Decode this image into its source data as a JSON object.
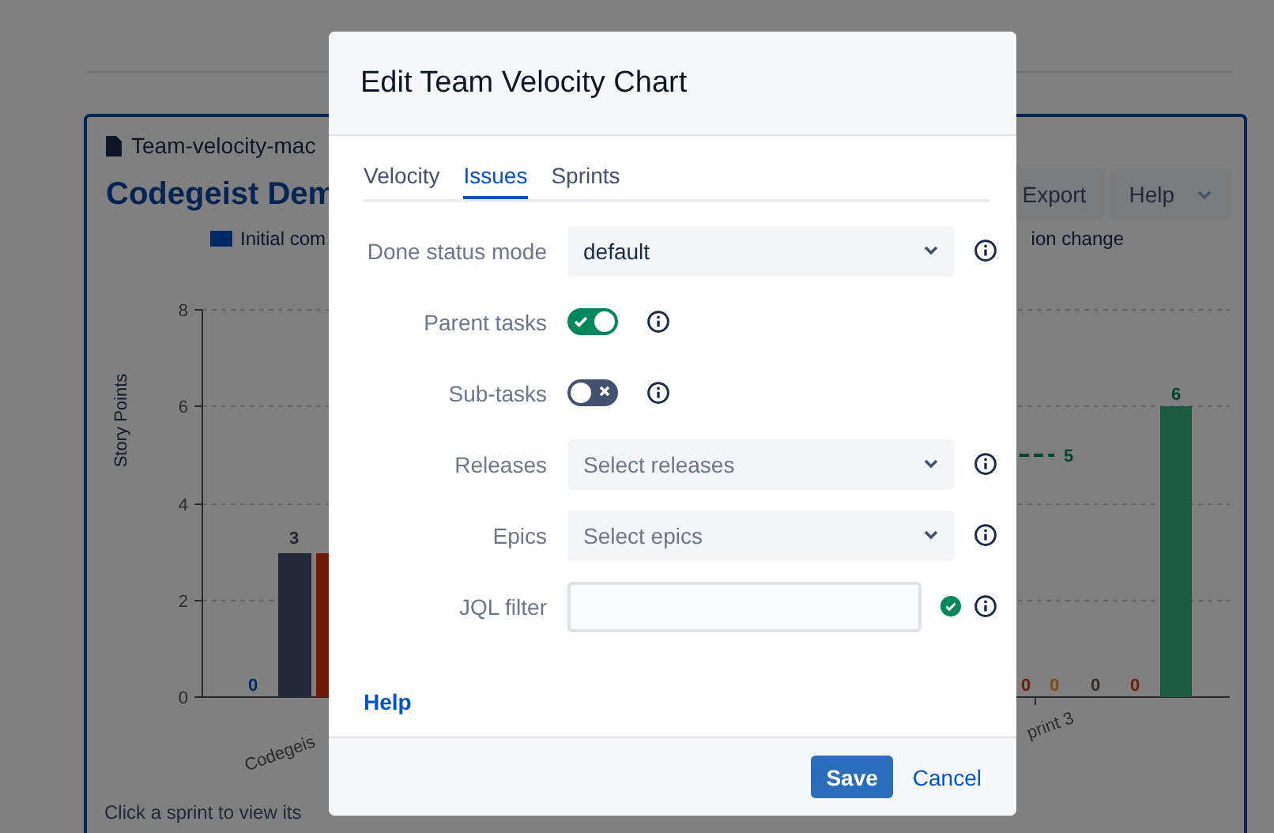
{
  "background": {
    "card": {
      "file_name": "Team-velocity-mac",
      "title": "Codegeist Dem",
      "buttons": [
        {
          "label": "Export",
          "kind": "plain"
        },
        {
          "label": "Help",
          "kind": "menu"
        }
      ],
      "legend": [
        {
          "label": "Initial com",
          "color": "#002966"
        },
        {
          "label": "ion change"
        }
      ],
      "chart": {
        "ylabel": "Story Points",
        "yticks": [
          "8",
          "6",
          "4",
          "2",
          "0"
        ],
        "xlabels": [
          "Codegeis",
          "print 3"
        ],
        "value_labels": [
          {
            "text": "0",
            "color": "#002966"
          },
          {
            "text": "3",
            "color": "#212937"
          },
          {
            "text": "5",
            "color": "#00442d"
          },
          {
            "text": "0",
            "color": "#6f1b06"
          },
          {
            "text": "0",
            "color": "#804d10"
          },
          {
            "text": "0",
            "color": "#362d27"
          },
          {
            "text": "0",
            "color": "#6f1b06"
          },
          {
            "text": "6",
            "color": "#00442d"
          }
        ]
      },
      "footer": "Click a sprint to view its"
    }
  },
  "dialog": {
    "title": "Edit Team Velocity Chart",
    "tabs": [
      {
        "label": "Velocity",
        "selected": false
      },
      {
        "label": "Issues",
        "selected": true
      },
      {
        "label": "Sprints",
        "selected": false
      }
    ],
    "fields": [
      {
        "label": "Done status mode",
        "kind": "select",
        "value": "default"
      },
      {
        "label": "Parent tasks",
        "kind": "toggle",
        "on": true
      },
      {
        "label": "Sub-tasks",
        "kind": "toggle",
        "on": false
      },
      {
        "label": "Releases",
        "kind": "select",
        "placeholder": "Select releases"
      },
      {
        "label": "Epics",
        "kind": "select",
        "placeholder": "Select epics"
      },
      {
        "label": "JQL filter",
        "kind": "text",
        "valid": true
      }
    ],
    "help_link": "Help",
    "buttons": [
      {
        "label": "Save",
        "kind": "primary"
      },
      {
        "label": "Cancel",
        "kind": "link"
      }
    ]
  }
}
